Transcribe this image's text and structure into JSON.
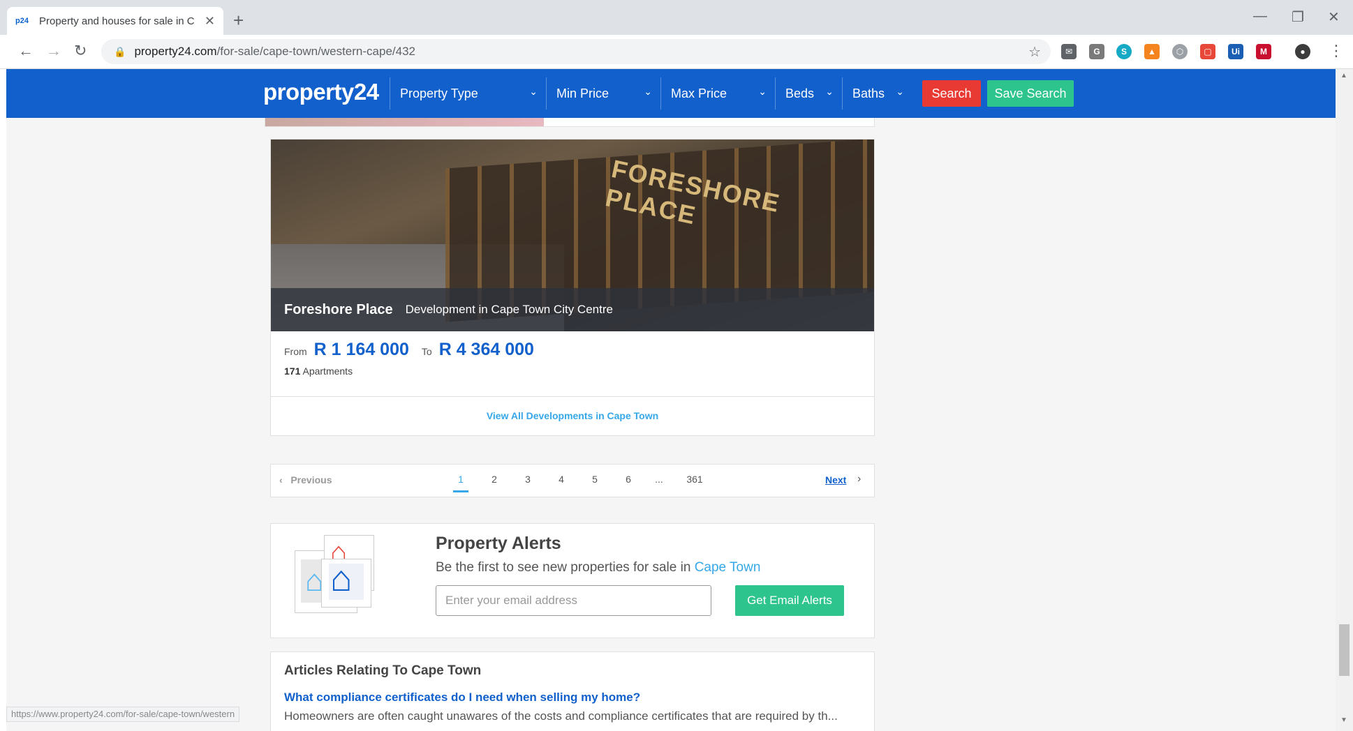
{
  "browser": {
    "tab_title": "Property and houses for sale in C",
    "tab_favicon": "p24",
    "url_host": "property24.com",
    "url_path": "/for-sale/cape-town/western-cape/432",
    "status_url": "https://www.property24.com/for-sale/cape-town/western"
  },
  "navbar": {
    "logo": "property24",
    "filters": [
      {
        "label": "Property Type"
      },
      {
        "label": "Min Price"
      },
      {
        "label": "Max Price"
      },
      {
        "label": "Beds"
      },
      {
        "label": "Baths"
      }
    ],
    "search_label": "Search",
    "save_search_label": "Save Search",
    "colors": {
      "bar": "#1160cc",
      "search": "#e83a32",
      "save": "#2dc48d"
    }
  },
  "development": {
    "image_sign": "FORESHORE PLACE",
    "name": "Foreshore Place",
    "subtitle": "Development in Cape Town City Centre",
    "from_label": "From",
    "price_from": "R 1 164 000",
    "to_label": "To",
    "price_to": "R 4 364 000",
    "count": "171",
    "count_label": "Apartments",
    "view_all": "View All Developments in Cape Town"
  },
  "pagination": {
    "previous": "Previous",
    "pages": [
      "1",
      "2",
      "3",
      "4",
      "5",
      "6",
      "...",
      "361"
    ],
    "current": "1",
    "next": "Next"
  },
  "alerts": {
    "title": "Property Alerts",
    "subtitle_prefix": "Be the first to see new properties for sale in",
    "subtitle_link": "Cape Town",
    "email_placeholder": "Enter your email address",
    "button": "Get Email Alerts"
  },
  "articles": {
    "title": "Articles Relating To Cape Town",
    "link": "What compliance certificates do I need when selling my home?",
    "snippet": "Homeowners are often caught unawares of the costs and compliance certificates that are required by th..."
  }
}
